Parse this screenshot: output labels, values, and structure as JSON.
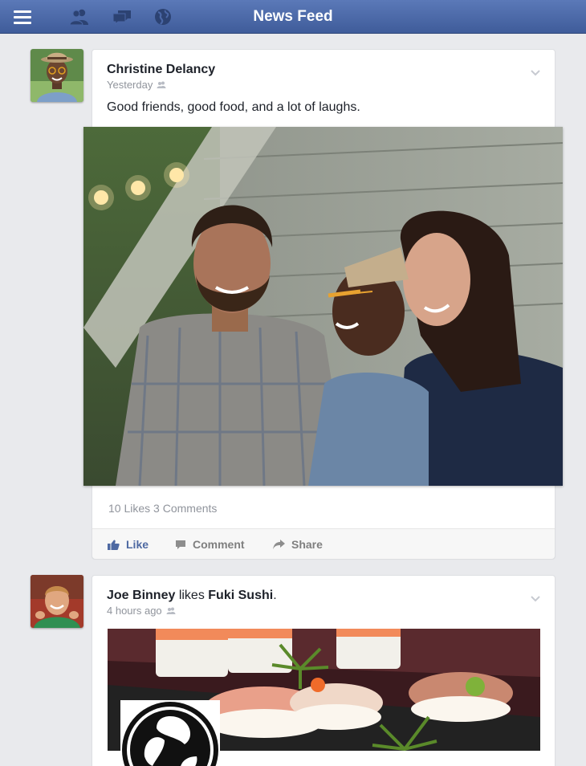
{
  "header": {
    "title": "News Feed",
    "icons": [
      "menu-icon",
      "friends-icon",
      "messages-icon",
      "globe-icon"
    ],
    "bar_color": "#4a67a6"
  },
  "posts": [
    {
      "author": "Christine Delancy",
      "time": "Yesterday",
      "privacy_icon": "friends-icon",
      "text": "Good friends, good food, and a lot of laughs.",
      "stats": {
        "likes": "10 Likes",
        "comments": "3 Comments"
      },
      "actions": {
        "like": "Like",
        "comment": "Comment",
        "share": "Share"
      }
    },
    {
      "author": "Joe Binney",
      "verb": "likes",
      "page": "Fuki Sushi",
      "period": ".",
      "time": "4 hours ago",
      "privacy_icon": "friends-icon"
    }
  ],
  "colors": {
    "background": "#e9eaed",
    "link": "#4e69a2",
    "meta": "#90949c"
  }
}
